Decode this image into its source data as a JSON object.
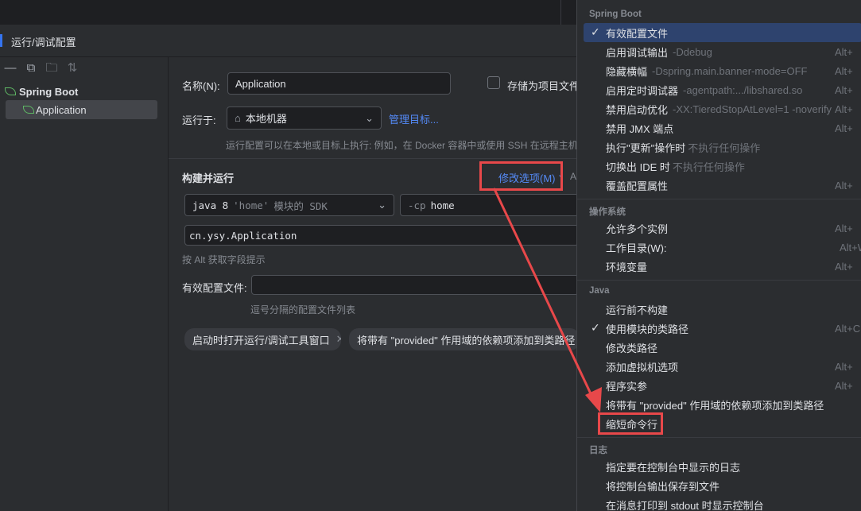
{
  "window": {
    "title": "运行/调试配置"
  },
  "sidebar": {
    "toolbar_icons": [
      "minus-icon",
      "copy-icon",
      "folder-plus-icon",
      "sort-icon"
    ],
    "tree": {
      "root": "Spring Boot",
      "child": "Application"
    }
  },
  "form": {
    "name_label": "名称(N):",
    "name_value": "Application",
    "store_label": "存储为项目文件",
    "run_on_label": "运行于:",
    "run_on_value": "本地机器",
    "manage_targets": "管理目标...",
    "run_on_hint": "运行配置可以在本地或目标上执行: 例如，在 Docker 容器中或使用 SSH 在远程主机上执行",
    "build_run_title": "构建并运行",
    "modify_options": "修改选项(M)",
    "sdk_prefix": "java 8",
    "sdk_module": "'home'",
    "sdk_suffix": "模块的 SDK",
    "cp_prefix": "-cp",
    "cp_value": "home",
    "main_class": "cn.ysy.Application",
    "alt_hint": "按 Alt 获取字段提示",
    "profiles_label": "有效配置文件:",
    "profiles_value": "",
    "profiles_hint": "逗号分隔的配置文件列表",
    "chips": [
      "启动时打开运行/调试工具窗口",
      "将带有 \"provided\" 作用域的依赖项添加到类路径"
    ]
  },
  "menu": {
    "sections": [
      {
        "title": "Spring Boot",
        "items": [
          {
            "label": "有效配置文件",
            "checked": true,
            "selected": true,
            "sub": "",
            "shortcut": ""
          },
          {
            "label": "启用调试输出",
            "sub": "-Ddebug",
            "shortcut": "Alt+"
          },
          {
            "label": "隐藏横幅",
            "sub": "-Dspring.main.banner-mode=OFF",
            "shortcut": "Alt+"
          },
          {
            "label": "启用定时调试器",
            "sub": "-agentpath:.../libshared.so",
            "shortcut": "Alt+"
          },
          {
            "label": "禁用启动优化",
            "sub": "-XX:TieredStopAtLevel=1 -noverify",
            "shortcut": "Alt+"
          },
          {
            "label": "禁用 JMX 端点",
            "sub": "",
            "shortcut": "Alt+"
          },
          {
            "label": "执行\"更新\"操作时",
            "sub": "不执行任何操作",
            "shortcut": ""
          },
          {
            "label": "切换出 IDE 时",
            "sub": "不执行任何操作",
            "shortcut": ""
          },
          {
            "label": "覆盖配置属性",
            "sub": "",
            "shortcut": "Alt+"
          }
        ]
      },
      {
        "title": "操作系统",
        "items": [
          {
            "label": "允许多个实例",
            "sub": "",
            "shortcut": "Alt+"
          },
          {
            "label": "工作目录(W):",
            "sub": "",
            "shortcut": "Alt+W"
          },
          {
            "label": "环境变量",
            "sub": "",
            "shortcut": "Alt+"
          }
        ]
      },
      {
        "title": "Java",
        "items": [
          {
            "label": "运行前不构建",
            "sub": "",
            "shortcut": ""
          },
          {
            "label": "使用模块的类路径",
            "checked": true,
            "sub": "",
            "shortcut": "Alt+C"
          },
          {
            "label": "修改类路径",
            "sub": "",
            "shortcut": ""
          },
          {
            "label": "添加虚拟机选项",
            "sub": "",
            "shortcut": "Alt+"
          },
          {
            "label": "程序实参",
            "sub": "",
            "shortcut": "Alt+"
          },
          {
            "label": "将带有 \"provided\" 作用域的依赖项添加到类路径",
            "sub": "",
            "shortcut": ""
          },
          {
            "label": "缩短命令行",
            "sub": "",
            "shortcut": "",
            "highlighted": true
          }
        ]
      },
      {
        "title": "日志",
        "items": [
          {
            "label": "指定要在控制台中显示的日志",
            "sub": "",
            "shortcut": ""
          },
          {
            "label": "将控制台输出保存到文件",
            "sub": "",
            "shortcut": ""
          },
          {
            "label": "在消息打印到 stdout 时显示控制台",
            "sub": "",
            "shortcut": ""
          }
        ]
      }
    ]
  },
  "colors": {
    "accent": "#3574f0",
    "annotation": "#e8484a",
    "selection": "#2e436e"
  }
}
